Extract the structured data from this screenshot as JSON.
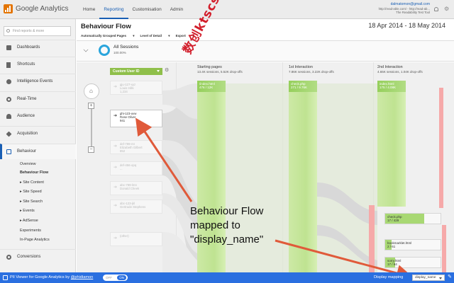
{
  "app": {
    "name": "Google Analytics"
  },
  "topnav": [
    "Home",
    "Reporting",
    "Customisation",
    "Admin"
  ],
  "account": {
    "email": "dalmatomon@gmail.com",
    "line2": "http://read-able.com/ - http://read-ab...",
    "line3": "The Readability Test Tool"
  },
  "sidebar": {
    "search_placeholder": "Find reports & more",
    "items": [
      "Dashboards",
      "Shortcuts",
      "Intelligence Events",
      "Real-Time",
      "Audience",
      "Acquisition",
      "Behaviour"
    ],
    "behaviour_sub": [
      "Overview",
      "Behaviour Flow",
      "Site Content",
      "Site Speed",
      "Site Search",
      "Events",
      "AdSense",
      "Experiments",
      "In-Page Analytics"
    ],
    "conversions": "Conversions"
  },
  "page": {
    "title": "Behaviour Flow",
    "daterange": "18 Apr 2014 - 18 May 2014",
    "toolbar": [
      "Automatically Grouped Pages",
      "Level of Detail",
      "Export"
    ]
  },
  "segment": {
    "label": "All Sessions",
    "percent": "100.00%"
  },
  "flow": {
    "dimension": "Custom User ID",
    "nodes": [
      {
        "line1": "gju-127-xyz",
        "line2": "Louis Hills",
        "line3": "1,234"
      },
      {
        "line1": "ghi-123-uvw",
        "line2": "Rose Oliver",
        "line3": "941"
      },
      {
        "line1": "def-789-rst",
        "line2": "Elizabeth Gilbert",
        "line3": "852"
      },
      {
        "line1": "def-456-opq",
        "line2": "...",
        "line3": ""
      },
      {
        "line1": "abc-789-lmn",
        "line2": "Donald Cheek",
        "line3": ""
      },
      {
        "line1": "abc-123-jkl",
        "line2": "Gertrude Stephens",
        "line3": ""
      },
      {
        "line1": "(other)",
        "line2": "",
        "line3": ""
      }
    ],
    "columns": [
      {
        "title": "Starting pages",
        "stats": "13.4K sessions, 5.52K drop-offs"
      },
      {
        "title": "1st Interaction",
        "stats": "7.86K sessions, 3.22K drop-offs"
      },
      {
        "title": "2nd Interaction",
        "stats": "4.65K sessions, 1.04K drop-offs"
      }
    ],
    "col_nodes": [
      {
        "name": "/index.html",
        "value": "476 / 12K"
      },
      {
        "name": "check.php",
        "value": "271 / 9.76K"
      },
      {
        "name": "index.html",
        "value": "175 / 4.08K"
      }
    ],
    "side_nodes": [
      {
        "name": "check.php",
        "value": "17 / 429",
        "fill": 0.7
      },
      {
        "name": "bookmarklet.html",
        "value": "2 / 61",
        "fill": 0.12
      },
      {
        "name": "sorry.html",
        "value": "17 / 64",
        "fill": 0.18
      }
    ]
  },
  "annotation": {
    "lines": [
      "Behaviour Flow",
      "mapped to",
      "\"display_name\""
    ],
    "stamp": "数创ktscs66"
  },
  "bottombar": {
    "title_prefix": "PII Viewer for Google Analytics",
    "by": "by",
    "author": "@phidiamon",
    "toggle_off": "OFF",
    "toggle_on": "ON",
    "mapping_label": "Display mapping",
    "mapping_value": "display_name"
  },
  "colors": {
    "accent": "#2a6fe0",
    "flow_green": "#b9e08c",
    "arrow_red": "#e05a3a",
    "sidebar_bg": "#f1f1f1"
  }
}
